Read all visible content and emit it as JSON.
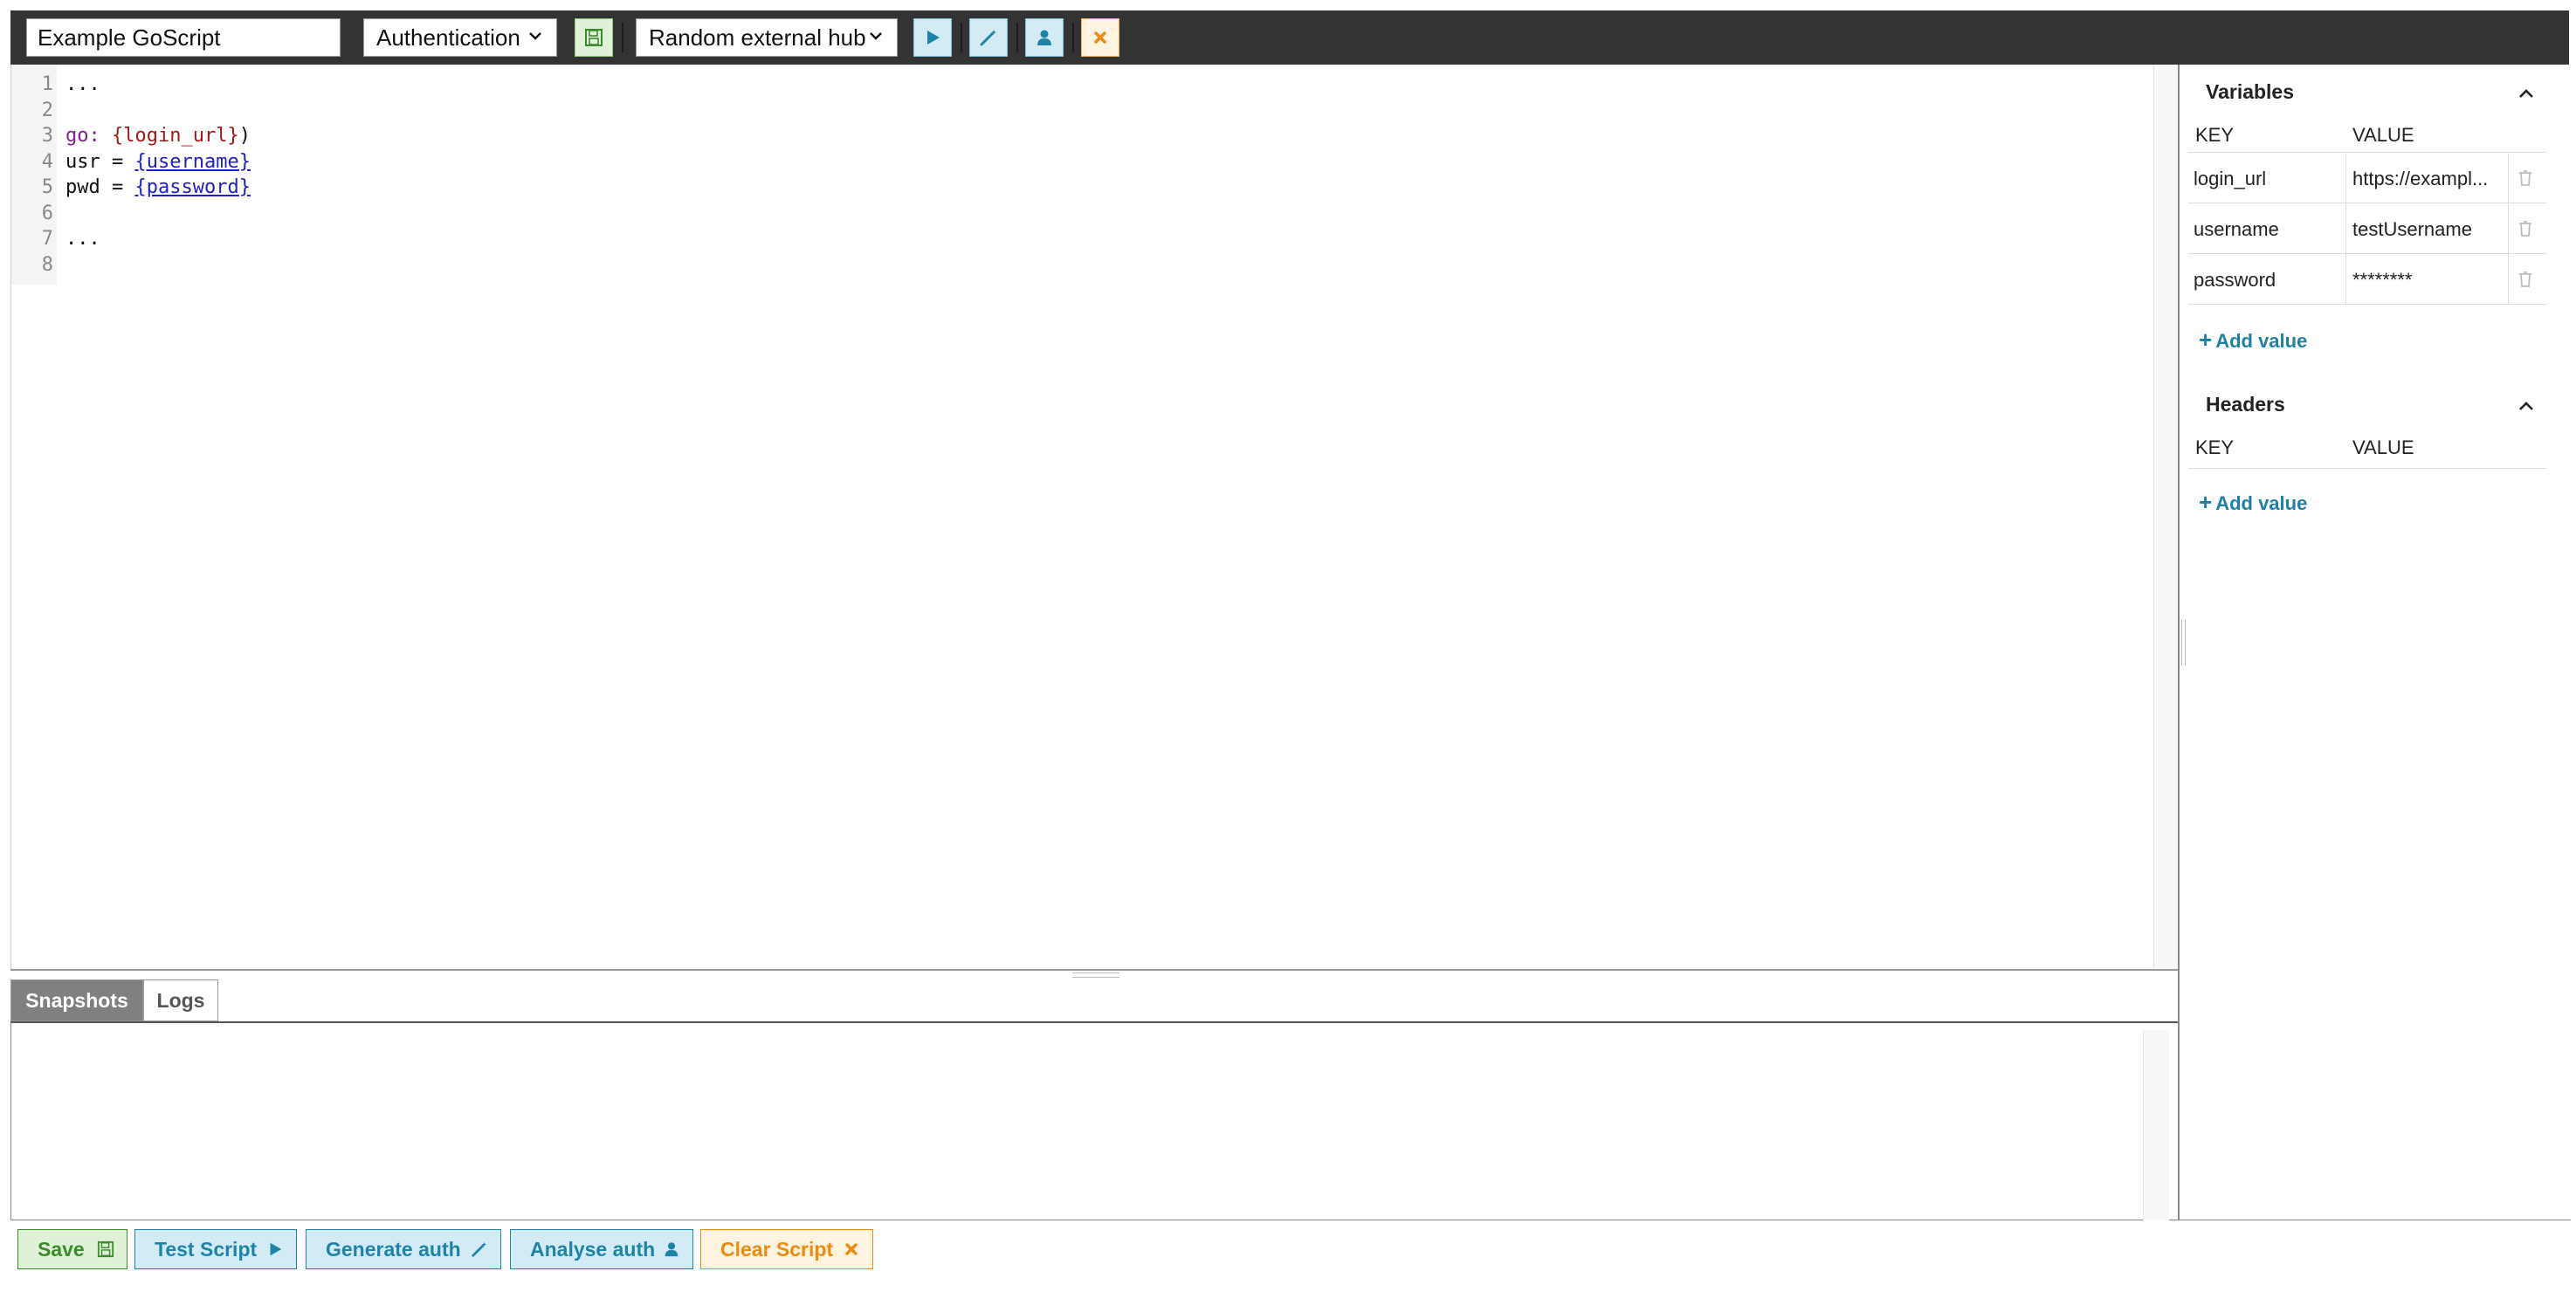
{
  "toolbar": {
    "script_name": "Example GoScript",
    "script_type": "Authentication",
    "hub": "Random external hub"
  },
  "editor": {
    "line_numbers": [
      "1",
      "2",
      "3",
      "4",
      "5",
      "6",
      "7",
      "8"
    ],
    "lines": [
      {
        "text": "..."
      },
      {
        "text": ""
      },
      {
        "kw": "go:",
        "param": "{login_url}",
        "rest": ")"
      },
      {
        "lhs": "usr = ",
        "var": "{username}"
      },
      {
        "lhs": "pwd = ",
        "var": "{password}"
      },
      {
        "text": ""
      },
      {
        "text": "..."
      },
      {
        "text": ""
      }
    ]
  },
  "bottom_panel": {
    "tabs": [
      {
        "label": "Snapshots"
      },
      {
        "label": "Logs"
      }
    ],
    "active_tab": "Snapshots"
  },
  "sidebar": {
    "variables": {
      "title": "Variables",
      "key_header": "KEY",
      "value_header": "VALUE",
      "rows": [
        {
          "key": "login_url",
          "value": "https://exampl..."
        },
        {
          "key": "username",
          "value": "testUsername"
        },
        {
          "key": "password",
          "value": "********"
        }
      ],
      "add_label": "Add value"
    },
    "headers": {
      "title": "Headers",
      "key_header": "KEY",
      "value_header": "VALUE",
      "rows": [],
      "add_label": "Add value"
    }
  },
  "actions": {
    "save": "Save",
    "test": "Test Script",
    "generate": "Generate auth",
    "analyse": "Analyse auth",
    "clear": "Clear Script"
  },
  "colors": {
    "toolbar_bg": "#333333",
    "save_green": "#3c8a2c",
    "action_blue": "#1f83a8",
    "clear_orange": "#ec8a12",
    "link_blue": "#1f7fa6"
  }
}
